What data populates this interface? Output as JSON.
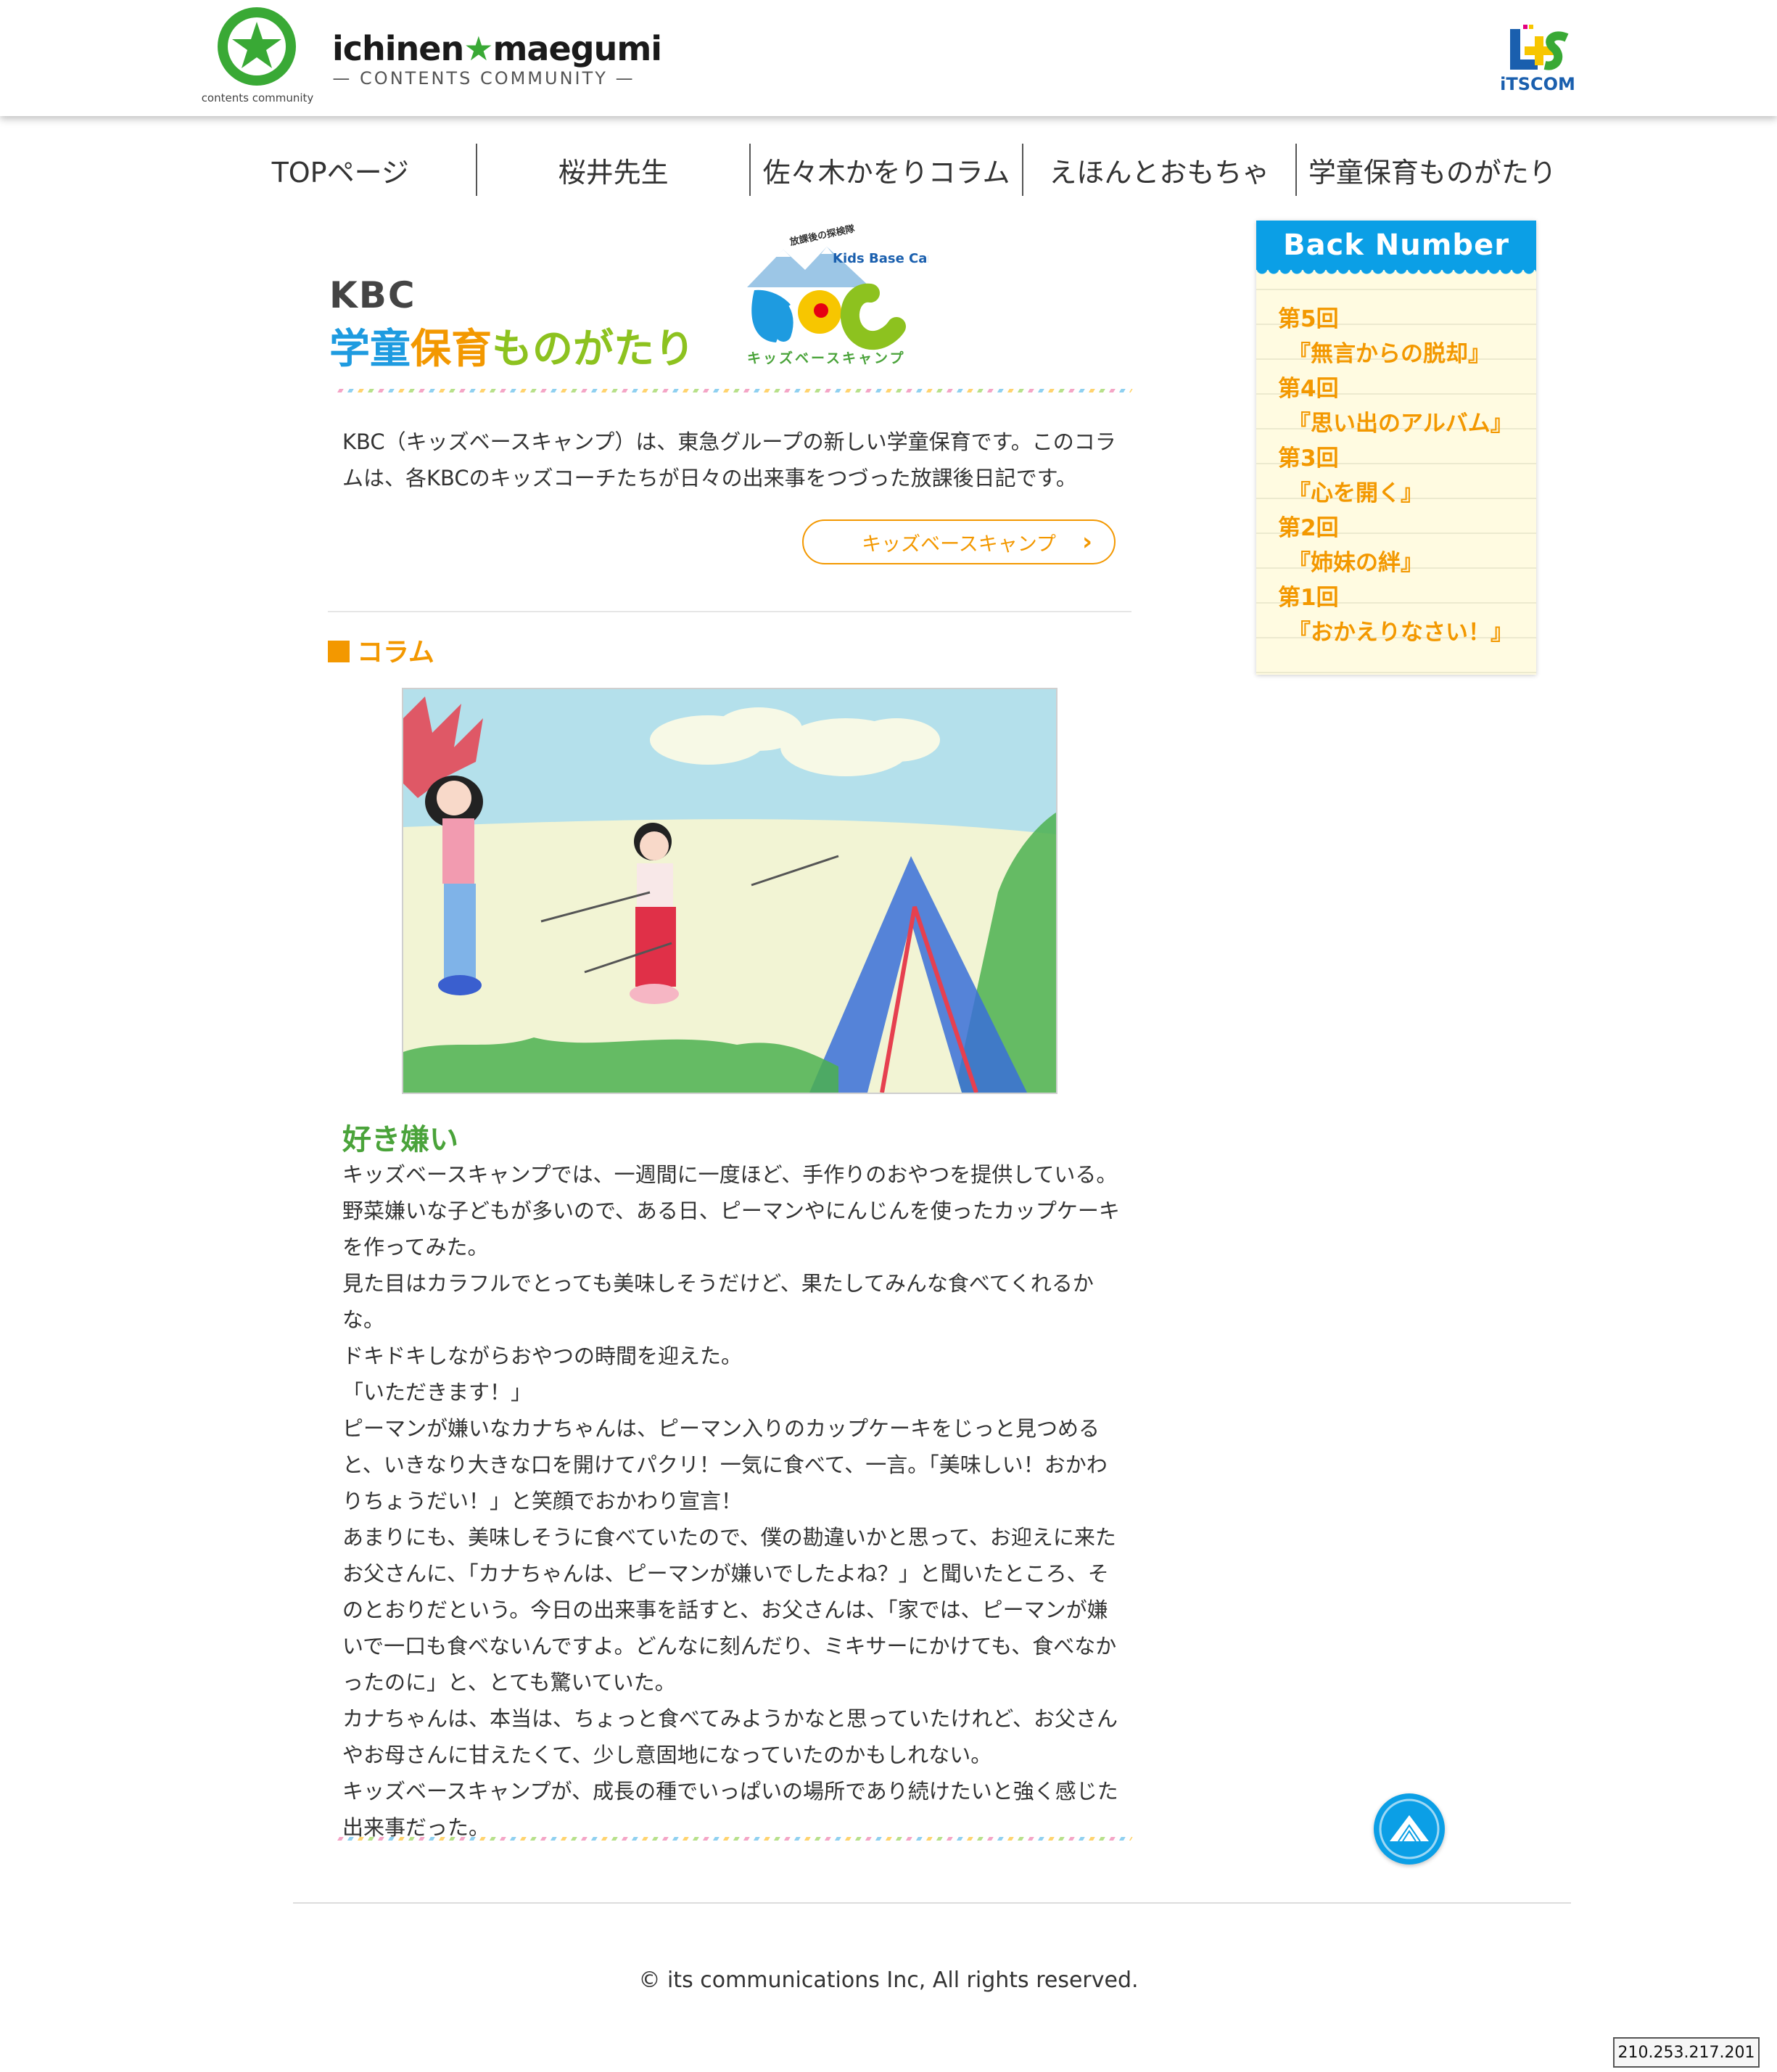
{
  "header": {
    "logo_caption": "contents community",
    "brand_left": "ichinen",
    "brand_right": "maegumi",
    "tagline": "— CONTENTS COMMUNITY —",
    "partner_logo_text": "iTSCOM"
  },
  "nav": {
    "items": [
      {
        "label": "TOPページ"
      },
      {
        "label": "桜井先生"
      },
      {
        "label": "佐々木かをりコラム"
      },
      {
        "label": "えほんとおもちゃ"
      },
      {
        "label": "学童保育ものがたり"
      }
    ]
  },
  "page": {
    "title_kbc": "KBC",
    "title_parts": [
      {
        "text": "学童",
        "color": "#1e9be0"
      },
      {
        "text": "保育",
        "color": "#f39800"
      },
      {
        "text": "ものがたり",
        "color": "#8dc21f"
      }
    ],
    "kbc_logo": {
      "arc_text": "放課後の探検隊",
      "camp_text": "Kids Base Camp",
      "kana_text": "キッズベースキャンプ"
    },
    "intro": "KBC（キッズベースキャンプ）は、東急グループの新しい学童保育です。このコラムは、各KBCのキッズコーチたちが日々の出来事をつづった放課後日記です。",
    "link_button": "キッズベースキャンプ",
    "section_heading": "コラム"
  },
  "article": {
    "title": "好き嫌い",
    "paragraphs": [
      "キッズベースキャンプでは、一週間に一度ほど、手作りのおやつを提供している。",
      "野菜嫌いな子どもが多いので、ある日、ピーマンやにんじんを使ったカップケーキを作ってみた。",
      "見た目はカラフルでとっても美味しそうだけど、果たしてみんな食べてくれるかな。",
      "ドキドキしながらおやつの時間を迎えた。",
      "「いただきます！」",
      "ピーマンが嫌いなカナちゃんは、ピーマン入りのカップケーキをじっと見つめると、いきなり大きな口を開けてパクリ！一気に食べて、一言。「美味しい！おかわりちょうだい！」と笑顔でおかわり宣言！",
      "あまりにも、美味しそうに食べていたので、僕の勘違いかと思って、お迎えに来たお父さんに、「カナちゃんは、ピーマンが嫌いでしたよね？」と聞いたところ、そのとおりだという。今日の出来事を話すと、お父さんは、「家では、ピーマンが嫌いで一口も食べないんですよ。どんなに刻んだり、ミキサーにかけても、食べなかったのに」と、とても驚いていた。",
      "カナちゃんは、本当は、ちょっと食べてみようかなと思っていたけれど、お父さんやお母さんに甘えたくて、少し意固地になっていたのかもしれない。",
      "キッズベースキャンプが、成長の種でいっぱいの場所であり続けたいと強く感じた出来事だった。"
    ]
  },
  "sidebar": {
    "header": "Back Number",
    "items": [
      {
        "number": "第5回",
        "title": "『無言からの脱却』"
      },
      {
        "number": "第4回",
        "title": "『思い出のアルバム』"
      },
      {
        "number": "第3回",
        "title": "『心を開く』"
      },
      {
        "number": "第2回",
        "title": "『姉妹の絆』"
      },
      {
        "number": "第1回",
        "title": "『おかえりなさい！』"
      }
    ]
  },
  "footer": {
    "copyright": "© its communications Inc, All rights reserved.",
    "ip": "210.253.217.201"
  },
  "colors": {
    "brand_green": "#39a935",
    "accent_orange": "#f39800",
    "accent_blue": "#0b9fe6",
    "title_green": "#4aa33a"
  }
}
